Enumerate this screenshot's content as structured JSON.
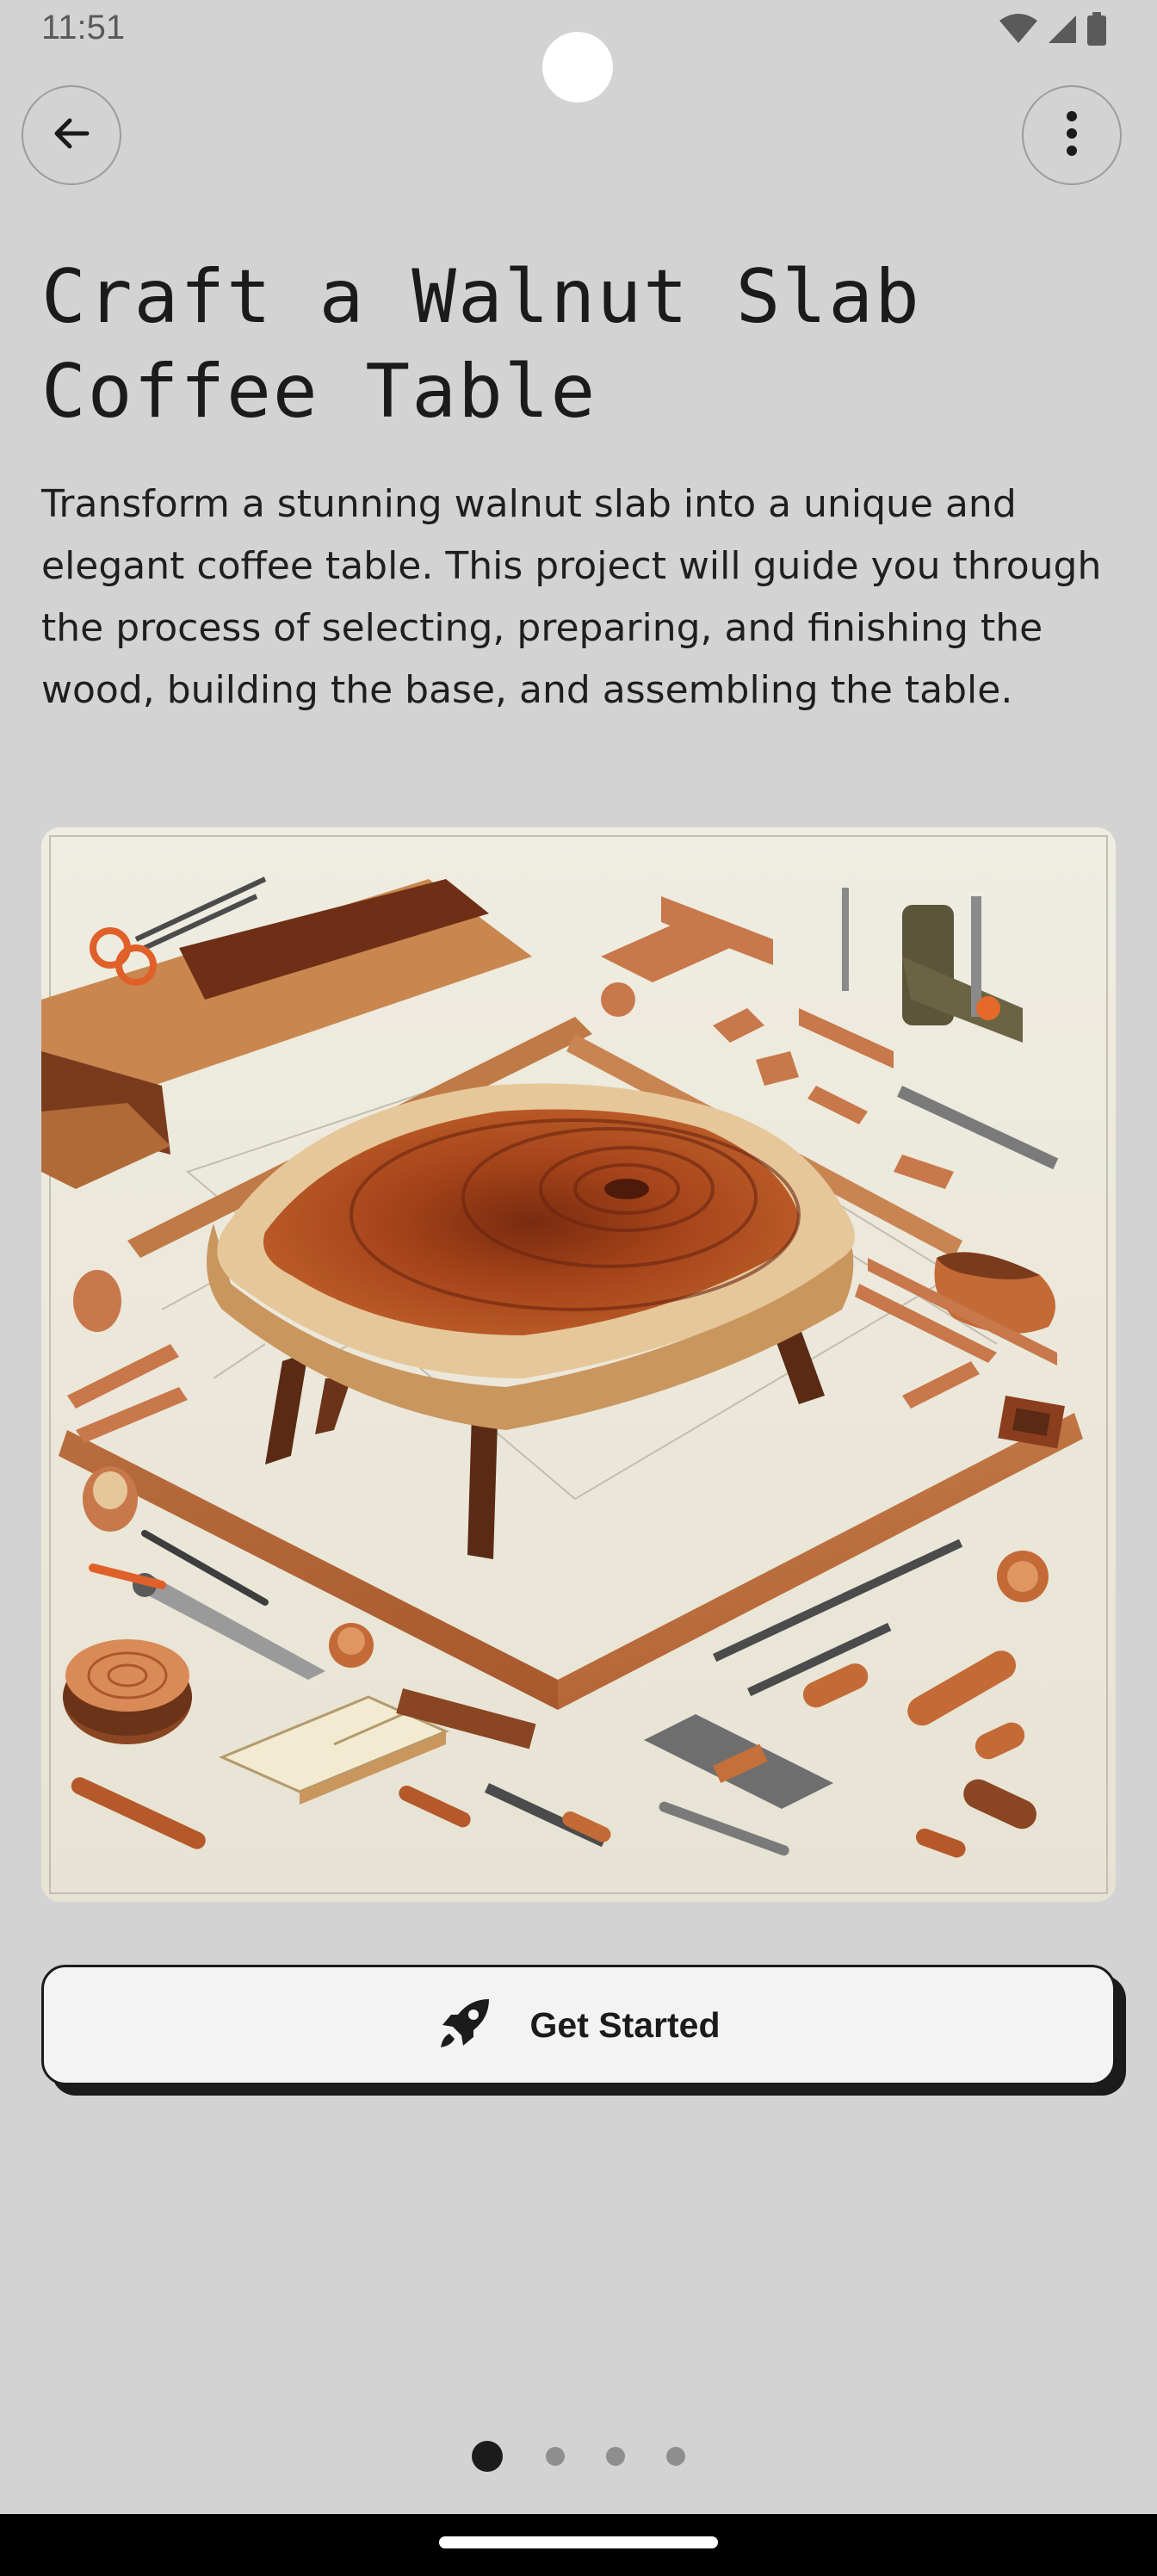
{
  "status_bar": {
    "time": "11:51",
    "icons": [
      "wifi-icon",
      "signal-icon",
      "battery-icon"
    ]
  },
  "top_bar": {
    "back_icon": "arrow-left-icon",
    "more_icon": "more-vertical-icon"
  },
  "content": {
    "title": "Craft a Walnut Slab Coffee Table",
    "description": "Transform a stunning walnut slab into a unique and elegant coffee table. This project will guide you through the process of selecting, preparing, and finishing the wood, building the base, and assembling the table.",
    "hero_image": "walnut-table-illustration"
  },
  "cta": {
    "label": "Get Started",
    "icon": "rocket-icon"
  },
  "pager": {
    "count": 4,
    "active_index": 0
  },
  "colors": {
    "background": "#d3d3d3",
    "text": "#1b1b1b",
    "button_fill": "#f3f3f3",
    "button_shadow": "#1b1b1b",
    "wood_dark": "#9b3f1c",
    "wood_light": "#e8c9a0"
  }
}
